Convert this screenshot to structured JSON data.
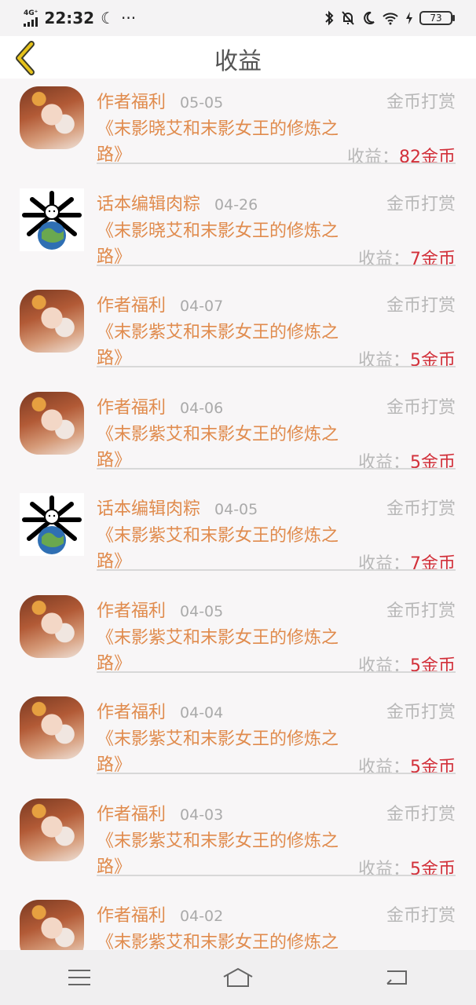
{
  "status_bar": {
    "network": "4G⁺",
    "time": "22:32",
    "moon": "☾",
    "more": "···",
    "battery": "73"
  },
  "header": {
    "title": "收益",
    "back_icon": "chevron-left-icon",
    "accent": "#e6c21a"
  },
  "earnings": [
    {
      "avatar": "girl",
      "author": "作者福利",
      "date": "05-05",
      "type": "金币打赏",
      "book": "《末影晓艾和末影女王的修炼之路》",
      "earn_label": "收益：",
      "earn_value": "82金币"
    },
    {
      "avatar": "editor",
      "author": "话本编辑肉粽",
      "date": "04-26",
      "type": "金币打赏",
      "book": "《末影晓艾和末影女王的修炼之路》",
      "earn_label": "收益：",
      "earn_value": "7金币"
    },
    {
      "avatar": "girl",
      "author": "作者福利",
      "date": "04-07",
      "type": "金币打赏",
      "book": "《末影紫艾和末影女王的修炼之路》",
      "earn_label": "收益：",
      "earn_value": "5金币"
    },
    {
      "avatar": "girl",
      "author": "作者福利",
      "date": "04-06",
      "type": "金币打赏",
      "book": "《末影紫艾和末影女王的修炼之路》",
      "earn_label": "收益：",
      "earn_value": "5金币"
    },
    {
      "avatar": "editor",
      "author": "话本编辑肉粽",
      "date": "04-05",
      "type": "金币打赏",
      "book": "《末影紫艾和末影女王的修炼之路》",
      "earn_label": "收益：",
      "earn_value": "7金币"
    },
    {
      "avatar": "girl",
      "author": "作者福利",
      "date": "04-05",
      "type": "金币打赏",
      "book": "《末影紫艾和末影女王的修炼之路》",
      "earn_label": "收益：",
      "earn_value": "5金币"
    },
    {
      "avatar": "girl",
      "author": "作者福利",
      "date": "04-04",
      "type": "金币打赏",
      "book": "《末影紫艾和末影女王的修炼之路》",
      "earn_label": "收益：",
      "earn_value": "5金币"
    },
    {
      "avatar": "girl",
      "author": "作者福利",
      "date": "04-03",
      "type": "金币打赏",
      "book": "《末影紫艾和末影女王的修炼之路》",
      "earn_label": "收益：",
      "earn_value": "5金币"
    },
    {
      "avatar": "girl",
      "author": "作者福利",
      "date": "04-02",
      "type": "金币打赏",
      "book": "《末影紫艾和末影女王的修炼之路》",
      "earn_label": "",
      "earn_value": ""
    }
  ],
  "colors": {
    "author": "#e08b4d",
    "earn_value": "#d2303a",
    "muted": "#b8b8b8"
  },
  "nav": {
    "menu_icon": "menu-icon",
    "home_icon": "home-icon",
    "back_icon": "back-icon"
  }
}
